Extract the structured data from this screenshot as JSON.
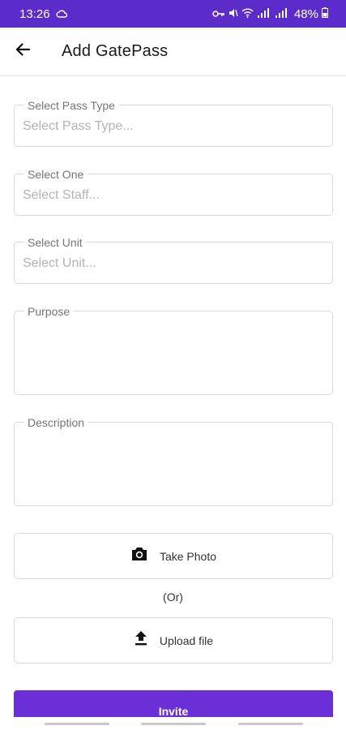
{
  "status_bar": {
    "time": "13:26",
    "battery_percent": "48%",
    "background": "#5b2cc9"
  },
  "app_bar": {
    "title": "Add GatePass"
  },
  "form": {
    "pass_type": {
      "label": "Select Pass Type",
      "placeholder": "Select Pass Type..."
    },
    "staff": {
      "label": "Select One",
      "placeholder": "Select Staff..."
    },
    "unit": {
      "label": "Select Unit",
      "placeholder": "Select Unit..."
    },
    "purpose": {
      "label": "Purpose"
    },
    "description": {
      "label": "Description"
    }
  },
  "actions": {
    "take_photo": "Take Photo",
    "or": "(Or)",
    "upload_file": "Upload file",
    "invite": "Invite"
  },
  "icons": {
    "back": "arrow-left-icon",
    "camera": "camera-icon",
    "upload": "upload-icon"
  },
  "colors": {
    "primary": "#6a2fd6"
  }
}
